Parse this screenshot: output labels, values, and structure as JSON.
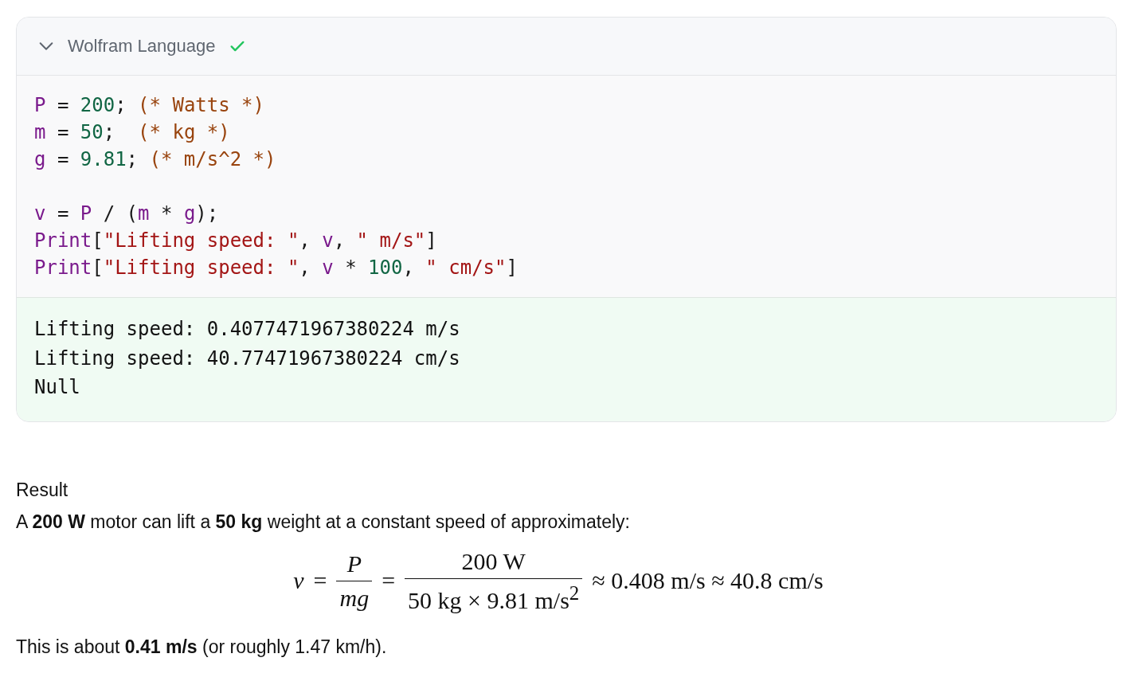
{
  "code_cell": {
    "language": "Wolfram Language",
    "expanded": true,
    "succeeded": true,
    "code_blocks": [
      [
        {
          "tokens": [
            {
              "kind": "var",
              "text": "P"
            },
            {
              "kind": "plain",
              "text": " = "
            },
            {
              "kind": "num",
              "text": "200"
            },
            {
              "kind": "plain",
              "text": "; "
            },
            {
              "kind": "comment",
              "text": "(* Watts *)"
            }
          ]
        },
        {
          "tokens": [
            {
              "kind": "var",
              "text": "m"
            },
            {
              "kind": "plain",
              "text": " = "
            },
            {
              "kind": "num",
              "text": "50"
            },
            {
              "kind": "plain",
              "text": ";  "
            },
            {
              "kind": "comment",
              "text": "(* kg *)"
            }
          ]
        },
        {
          "tokens": [
            {
              "kind": "var",
              "text": "g"
            },
            {
              "kind": "plain",
              "text": " = "
            },
            {
              "kind": "num",
              "text": "9.81"
            },
            {
              "kind": "plain",
              "text": "; "
            },
            {
              "kind": "comment",
              "text": "(* m/s^2 *)"
            }
          ]
        }
      ],
      [
        {
          "tokens": [
            {
              "kind": "var",
              "text": "v"
            },
            {
              "kind": "plain",
              "text": " = "
            },
            {
              "kind": "var",
              "text": "P"
            },
            {
              "kind": "plain",
              "text": " / ("
            },
            {
              "kind": "var",
              "text": "m"
            },
            {
              "kind": "plain",
              "text": " * "
            },
            {
              "kind": "var",
              "text": "g"
            },
            {
              "kind": "plain",
              "text": ");"
            }
          ]
        },
        {
          "tokens": [
            {
              "kind": "var",
              "text": "Print"
            },
            {
              "kind": "plain",
              "text": "["
            },
            {
              "kind": "str",
              "text": "\"Lifting speed: \""
            },
            {
              "kind": "plain",
              "text": ", "
            },
            {
              "kind": "var",
              "text": "v"
            },
            {
              "kind": "plain",
              "text": ", "
            },
            {
              "kind": "str",
              "text": "\" m/s\""
            },
            {
              "kind": "plain",
              "text": "]"
            }
          ]
        },
        {
          "tokens": [
            {
              "kind": "var",
              "text": "Print"
            },
            {
              "kind": "plain",
              "text": "["
            },
            {
              "kind": "str",
              "text": "\"Lifting speed: \""
            },
            {
              "kind": "plain",
              "text": ", "
            },
            {
              "kind": "var",
              "text": "v"
            },
            {
              "kind": "plain",
              "text": " * "
            },
            {
              "kind": "num",
              "text": "100"
            },
            {
              "kind": "plain",
              "text": ", "
            },
            {
              "kind": "str",
              "text": "\" cm/s\""
            },
            {
              "kind": "plain",
              "text": "]"
            }
          ]
        }
      ]
    ],
    "output": [
      "Lifting speed: 0.4077471967380224 m/s",
      "Lifting speed: 40.77471967380224 cm/s",
      "Null"
    ]
  },
  "result": {
    "heading": "Result",
    "intro": "A **200 W** motor can lift a **50 kg** weight at a constant speed of approximately:",
    "formula": [
      {
        "kind": "italic",
        "text": "v"
      },
      {
        "kind": "text",
        "text": "="
      },
      {
        "kind": "fraction",
        "numerator": "*P*",
        "denominator": "*mg*"
      },
      {
        "kind": "text",
        "text": "="
      },
      {
        "kind": "fraction",
        "numerator": "200 W",
        "denominator": "50 kg × 9.81 m/s$^{2}$"
      },
      {
        "kind": "text",
        "text": "≈ 0.408 m/s ≈ 40.8 cm/s"
      }
    ],
    "summary": "This is about **0.41 m/s** (or roughly 1.47 km/h)."
  }
}
